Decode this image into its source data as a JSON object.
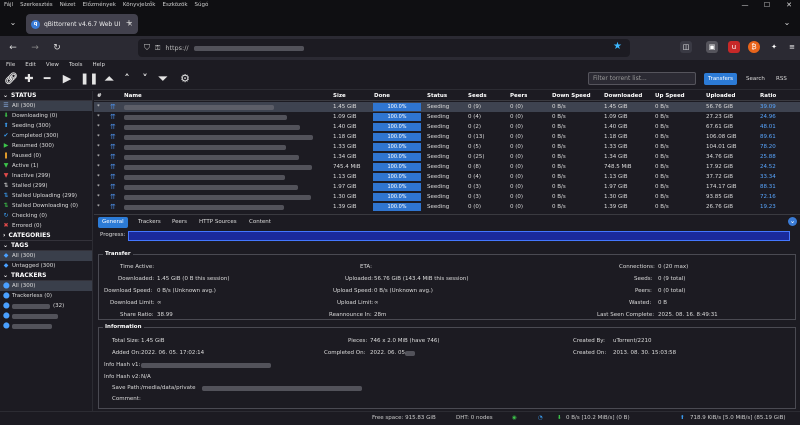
{
  "os_menu": [
    "Fájl",
    "Szerkesztés",
    "Nézet",
    "Előzmények",
    "Könyvjelzők",
    "Eszközök",
    "Súgó"
  ],
  "window_controls": [
    "—",
    "☐",
    "✕"
  ],
  "browser": {
    "tab_title": "qBittorrent v4.6.7 Web UI",
    "tab_close": "×",
    "new_tab": "+",
    "url_prefix": "https://",
    "icons": [
      "back-icon",
      "forward-icon",
      "reload-icon",
      "shield-icon",
      "lock-icon",
      "star-icon",
      "pocket-icon",
      "extension-icon",
      "menu-icon"
    ]
  },
  "app_menu": [
    "File",
    "Edit",
    "View",
    "Tools",
    "Help"
  ],
  "toolbar": {
    "filter_placeholder": "Filter torrent list...",
    "view_tabs": [
      "Transfers",
      "Search",
      "RSS"
    ],
    "icons": [
      "link-icon",
      "add-icon",
      "remove-icon",
      "resume-icon",
      "pause-icon",
      "queue-up-icon",
      "queue-top-icon",
      "queue-bottom-icon",
      "queue-down-icon",
      "settings-icon"
    ]
  },
  "sidebar": {
    "status_title": "STATUS",
    "status_items": [
      {
        "label": "All (300)",
        "icon": "all-icon",
        "color": "#8fb3e8"
      },
      {
        "label": "Downloading (0)",
        "icon": "download-icon",
        "color": "#3cc44a"
      },
      {
        "label": "Seeding (300)",
        "icon": "upload-icon",
        "color": "#3a9bef"
      },
      {
        "label": "Completed (300)",
        "icon": "check-icon",
        "color": "#3a9bef"
      },
      {
        "label": "Resumed (300)",
        "icon": "resume-icon",
        "color": "#3cc44a"
      },
      {
        "label": "Paused (0)",
        "icon": "pause-icon",
        "color": "#e09a2a"
      },
      {
        "label": "Active (1)",
        "icon": "filter-icon",
        "color": "#3cc44a"
      },
      {
        "label": "Inactive (299)",
        "icon": "filter-icon",
        "color": "#e04a4a"
      },
      {
        "label": "Stalled (299)",
        "icon": "stalled-icon",
        "color": "#cccccc"
      },
      {
        "label": "Stalled Uploading (299)",
        "icon": "stalled-up-icon",
        "color": "#3a9bef"
      },
      {
        "label": "Stalled Downloading (0)",
        "icon": "stalled-down-icon",
        "color": "#3cc44a"
      },
      {
        "label": "Checking (0)",
        "icon": "checking-icon",
        "color": "#3a9bef"
      },
      {
        "label": "Errored (0)",
        "icon": "error-icon",
        "color": "#e04a4a"
      }
    ],
    "categories_title": "CATEGORIES",
    "tags_title": "TAGS",
    "tags_items": [
      {
        "label": "All (300)"
      },
      {
        "label": "Untagged (300)"
      }
    ],
    "trackers_title": "TRACKERS",
    "trackers_items": [
      {
        "label": "All (300)"
      },
      {
        "label": "Trackerless (0)"
      },
      {
        "label": "(32)"
      },
      {
        "label": ""
      },
      {
        "label": ""
      }
    ]
  },
  "table": {
    "headers": [
      "#",
      "Name",
      "Size",
      "Done",
      "Status",
      "Seeds",
      "Peers",
      "Down Speed",
      "Downloaded",
      "Up Speed",
      "Uploaded",
      "Ratio"
    ],
    "rows": [
      {
        "num": "*",
        "size": "1.45 GiB",
        "done": "100.0%",
        "status": "Seeding",
        "seeds": "0 (9)",
        "peers": "0 (0)",
        "down": "0 B/s",
        "downloaded": "1.45 GiB",
        "up": "0 B/s",
        "uploaded": "56.76 GiB",
        "ratio": "39.09"
      },
      {
        "num": "*",
        "size": "1.09 GiB",
        "done": "100.0%",
        "status": "Seeding",
        "seeds": "0 (4)",
        "peers": "0 (0)",
        "down": "0 B/s",
        "downloaded": "1.09 GiB",
        "up": "0 B/s",
        "uploaded": "27.23 GiB",
        "ratio": "24.96"
      },
      {
        "num": "*",
        "size": "1.40 GiB",
        "done": "100.0%",
        "status": "Seeding",
        "seeds": "0 (2)",
        "peers": "0 (0)",
        "down": "0 B/s",
        "downloaded": "1.40 GiB",
        "up": "0 B/s",
        "uploaded": "67.61 GiB",
        "ratio": "48.01"
      },
      {
        "num": "*",
        "size": "1.18 GiB",
        "done": "100.0%",
        "status": "Seeding",
        "seeds": "0 (13)",
        "peers": "0 (0)",
        "down": "0 B/s",
        "downloaded": "1.18 GiB",
        "up": "0 B/s",
        "uploaded": "106.08 GiB",
        "ratio": "89.61"
      },
      {
        "num": "*",
        "size": "1.33 GiB",
        "done": "100.0%",
        "status": "Seeding",
        "seeds": "0 (5)",
        "peers": "0 (0)",
        "down": "0 B/s",
        "downloaded": "1.33 GiB",
        "up": "0 B/s",
        "uploaded": "104.01 GiB",
        "ratio": "78.20"
      },
      {
        "num": "*",
        "size": "1.34 GiB",
        "done": "100.0%",
        "status": "Seeding",
        "seeds": "0 (25)",
        "peers": "0 (0)",
        "down": "0 B/s",
        "downloaded": "1.34 GiB",
        "up": "0 B/s",
        "uploaded": "34.76 GiB",
        "ratio": "25.88"
      },
      {
        "num": "*",
        "size": "745.4 MiB",
        "done": "100.0%",
        "status": "Seeding",
        "seeds": "0 (8)",
        "peers": "0 (0)",
        "down": "0 B/s",
        "downloaded": "748.5 MiB",
        "up": "0 B/s",
        "uploaded": "17.92 GiB",
        "ratio": "24.52"
      },
      {
        "num": "*",
        "size": "1.13 GiB",
        "done": "100.0%",
        "status": "Seeding",
        "seeds": "0 (4)",
        "peers": "0 (0)",
        "down": "0 B/s",
        "downloaded": "1.13 GiB",
        "up": "0 B/s",
        "uploaded": "37.72 GiB",
        "ratio": "33.34"
      },
      {
        "num": "*",
        "size": "1.97 GiB",
        "done": "100.0%",
        "status": "Seeding",
        "seeds": "0 (3)",
        "peers": "0 (0)",
        "down": "0 B/s",
        "downloaded": "1.97 GiB",
        "up": "0 B/s",
        "uploaded": "174.17 GiB",
        "ratio": "88.31"
      },
      {
        "num": "*",
        "size": "1.30 GiB",
        "done": "100.0%",
        "status": "Seeding",
        "seeds": "0 (3)",
        "peers": "0 (0)",
        "down": "0 B/s",
        "downloaded": "1.30 GiB",
        "up": "0 B/s",
        "uploaded": "93.85 GiB",
        "ratio": "72.16"
      },
      {
        "num": "*",
        "size": "1.39 GiB",
        "done": "100.0%",
        "status": "Seeding",
        "seeds": "0 (0)",
        "peers": "0 (0)",
        "down": "0 B/s",
        "downloaded": "1.39 GiB",
        "up": "0 B/s",
        "uploaded": "26.76 GiB",
        "ratio": "19.23"
      }
    ]
  },
  "properties": {
    "tabs": [
      "General",
      "Trackers",
      "Peers",
      "HTTP Sources",
      "Content"
    ],
    "progress_label": "Progress:",
    "transfer_title": "Transfer",
    "transfer": {
      "time_active": "Time Active:",
      "time_active_val": "",
      "eta": "ETA:",
      "eta_val": "",
      "connections": "Connections:",
      "connections_val": "0 (20 max)",
      "downloaded": "Downloaded:",
      "downloaded_val": "1.45 GiB (0 B this session)",
      "uploaded": "Uploaded:",
      "uploaded_val": "56.76 GiB (143.4 MiB this session)",
      "seeds": "Seeds:",
      "seeds_val": "0 (9 total)",
      "down_speed": "Download Speed:",
      "down_speed_val": "0 B/s (Unknown avg.)",
      "up_speed": "Upload Speed:",
      "up_speed_val": "0 B/s (Unknown avg.)",
      "peers": "Peers:",
      "peers_val": "0 (0 total)",
      "dl_limit": "Download Limit:",
      "dl_limit_val": "∞",
      "ul_limit": "Upload Limit:",
      "ul_limit_val": "∞",
      "wasted": "Wasted:",
      "wasted_val": "0 B",
      "share_ratio": "Share Ratio:",
      "share_ratio_val": "38.99",
      "reannounce": "Reannounce In:",
      "reannounce_val": "28m",
      "last_seen": "Last Seen Complete:",
      "last_seen_val": "2025. 08. 16. 8:49:31"
    },
    "info_title": "Information",
    "info": {
      "total_size": "Total Size:",
      "total_size_val": "1.45 GiB",
      "pieces": "Pieces:",
      "pieces_val": "746 x 2.0 MiB (have 746)",
      "created_by": "Created By:",
      "created_by_val": "uTorrent/2210",
      "added_on": "Added On:",
      "added_on_val": "2022. 06. 05. 17:02:14",
      "completed_on": "Completed On:",
      "completed_on_val": "2022. 06. 05.",
      "created_on": "Created On:",
      "created_on_val": "2013. 08. 30. 15:03:58",
      "hash_v1": "Info Hash v1:",
      "hash_v2": "Info Hash v2:",
      "hash_v2_val": "N/A",
      "save_path": "Save Path:",
      "save_path_val": "/media/data/private",
      "comment": "Comment:"
    }
  },
  "statusbar": {
    "free_space": "Free space: 915.83 GiB",
    "dht": "DHT: 0 nodes",
    "down": "0 B/s [10.2 MiB/s] (0 B)",
    "up": "718.9 KiB/s [5.0 MiB/s] (85.19 GiB)"
  },
  "colors": {
    "accent": "#2c7bd6",
    "progress": "#2f75d0",
    "ratio": "#58a6ff"
  }
}
